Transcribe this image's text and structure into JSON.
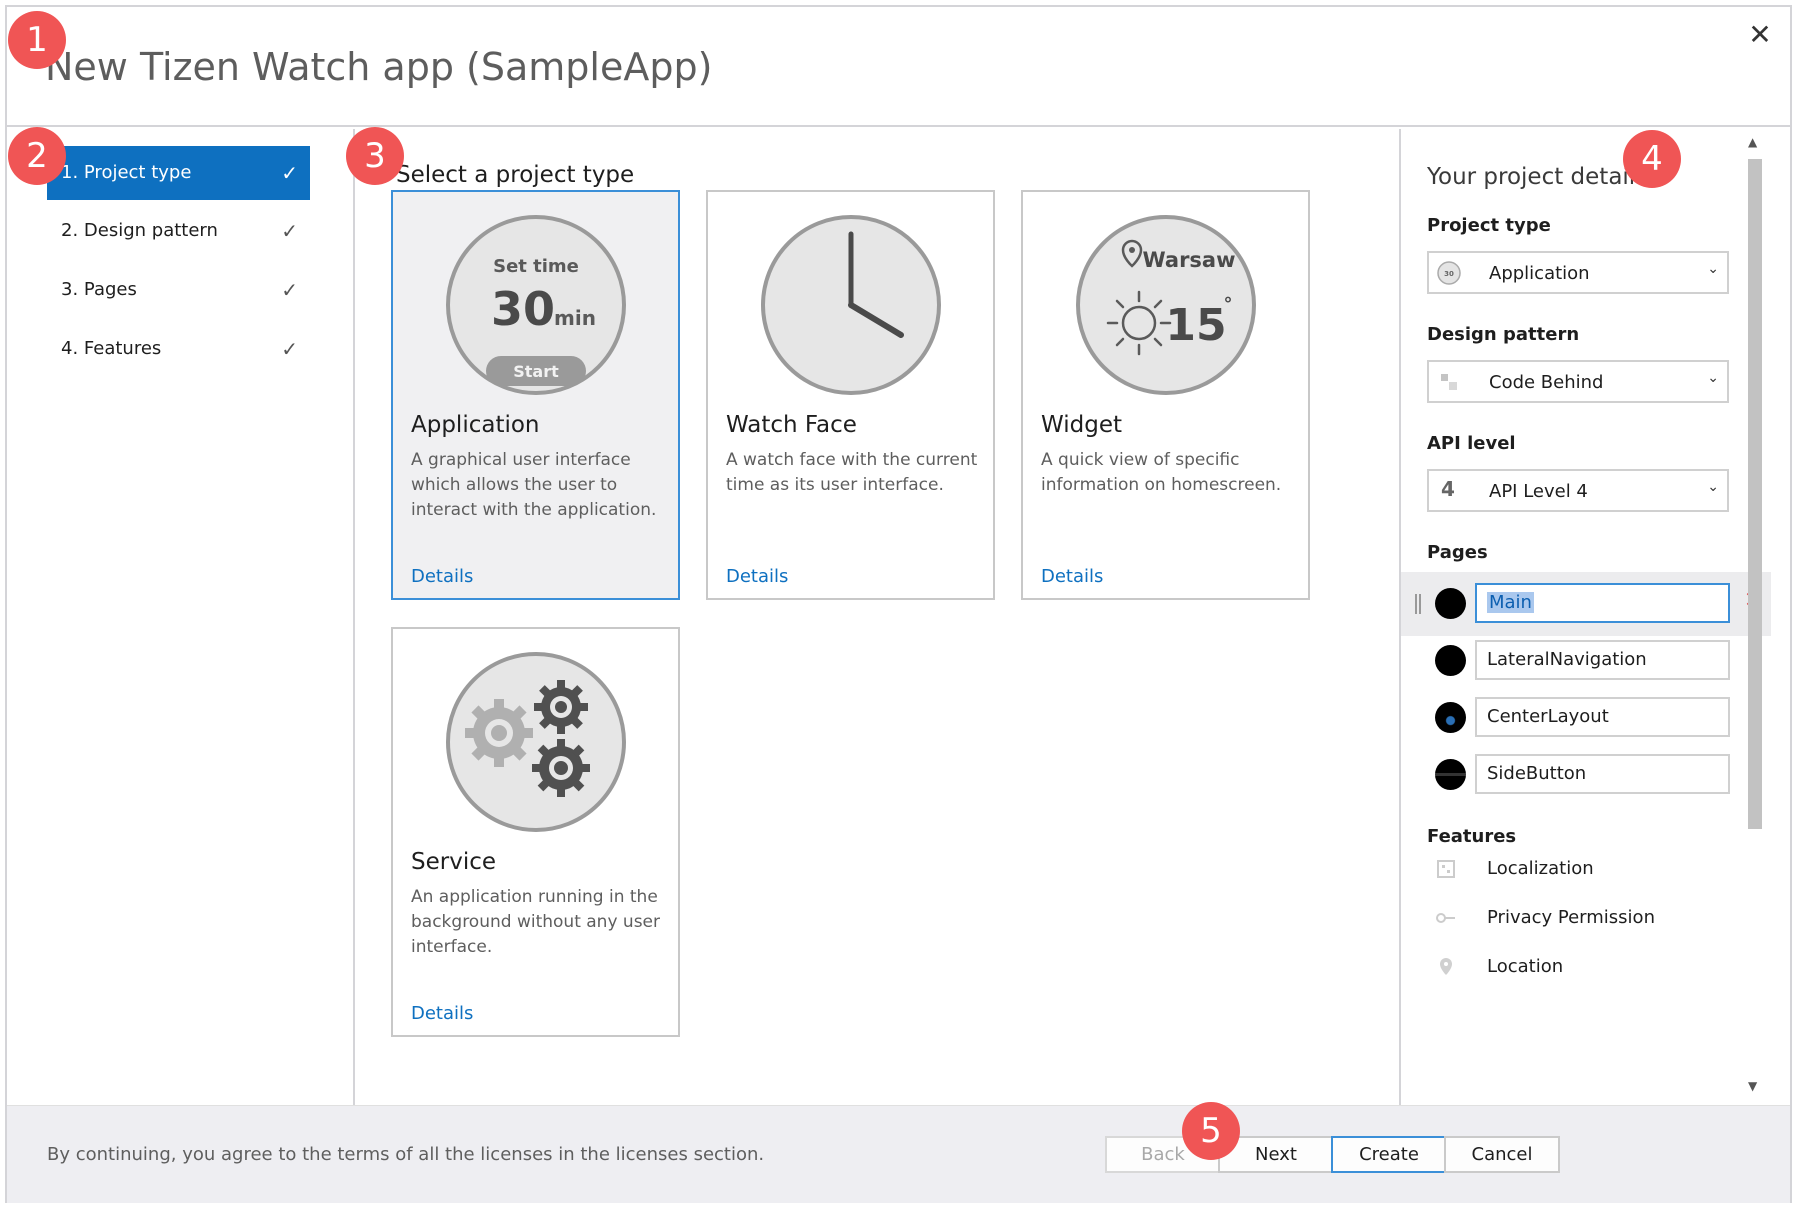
{
  "window": {
    "title": "New Tizen Watch app (SampleApp)",
    "close_glyph": "✕"
  },
  "steps": [
    {
      "label": "1. Project type",
      "check": "✓"
    },
    {
      "label": "2. Design pattern",
      "check": "✓"
    },
    {
      "label": "3. Pages",
      "check": "✓"
    },
    {
      "label": "4. Features",
      "check": "✓"
    }
  ],
  "main": {
    "section_title": "Select a project type",
    "cards": [
      {
        "title": "Application",
        "description": "A graphical user interface which allows the user to interact with the application.",
        "link": "Details",
        "illus": {
          "top_text": "Set time",
          "value": "30",
          "unit": "min",
          "button": "Start"
        }
      },
      {
        "title": "Watch Face",
        "description": "A watch face with the current time as its user interface.",
        "link": "Details"
      },
      {
        "title": "Widget",
        "description": "A quick view of specific information on homescreen.",
        "link": "Details",
        "illus": {
          "city": "Warsaw",
          "temp": "15",
          "degree": "°"
        }
      },
      {
        "title": "Service",
        "description": "An application running in the background without any user interface.",
        "link": "Details"
      }
    ]
  },
  "details": {
    "title": "Your project details",
    "project_type": {
      "label": "Project type",
      "value": "Application",
      "icon_text": "30"
    },
    "design_pattern": {
      "label": "Design pattern",
      "value": "Code Behind"
    },
    "api_level": {
      "label": "API level",
      "value": "API Level 4",
      "icon_text": "4"
    },
    "pages": {
      "label": "Pages",
      "items": [
        "Main",
        "LateralNavigation",
        "CenterLayout",
        "SideButton"
      ],
      "remove_glyph": "✕"
    },
    "features": {
      "label": "Features",
      "items": [
        "Localization",
        "Privacy Permission",
        "Location"
      ]
    },
    "chevron": "⌄",
    "scroll_up": "▲",
    "scroll_down": "▼"
  },
  "footer": {
    "notice": "By continuing, you agree to the terms of all the licenses in the licenses section.",
    "buttons": {
      "back": "Back",
      "next": "Next",
      "create": "Create",
      "cancel": "Cancel"
    }
  },
  "markers": [
    "1",
    "2",
    "3",
    "4",
    "5"
  ],
  "colors": {
    "accent": "#0e70c0",
    "marker": "#f05555",
    "selected_border": "#3b8fd8"
  }
}
